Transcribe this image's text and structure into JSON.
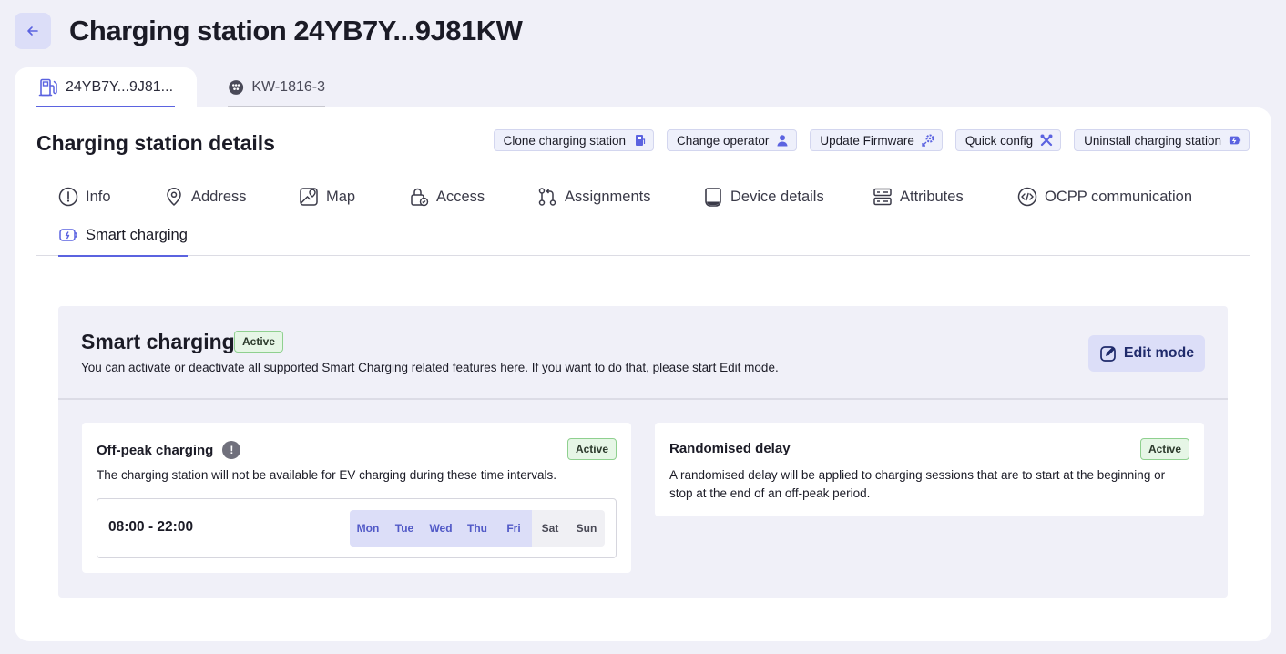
{
  "header": {
    "title_prefix": "Charging station",
    "title_id": "24YB7Y...9J81KW"
  },
  "top_tabs": [
    {
      "label": "24YB7Y...9J81...",
      "icon": "fuel-pump-icon",
      "active": true
    },
    {
      "label": "KW-1816-3",
      "icon": "ev-connector-icon",
      "active": false
    }
  ],
  "section": {
    "title": "Charging station details",
    "actions": [
      {
        "label": "Clone charging station",
        "icon": "clone-station-icon"
      },
      {
        "label": "Change operator",
        "icon": "user-icon"
      },
      {
        "label": "Update Firmware",
        "icon": "firmware-gear-icon"
      },
      {
        "label": "Quick config",
        "icon": "tools-icon"
      },
      {
        "label": "Uninstall charging station",
        "icon": "uninstall-icon"
      }
    ]
  },
  "nav_tabs": [
    {
      "label": "Info",
      "icon": "info-icon"
    },
    {
      "label": "Address",
      "icon": "location-pin-icon"
    },
    {
      "label": "Map",
      "icon": "map-icon"
    },
    {
      "label": "Access",
      "icon": "lock-icon"
    },
    {
      "label": "Assignments",
      "icon": "assignments-icon"
    },
    {
      "label": "Device details",
      "icon": "device-icon"
    },
    {
      "label": "Attributes",
      "icon": "attributes-icon"
    },
    {
      "label": "OCPP communication",
      "icon": "code-icon"
    },
    {
      "label": "Smart charging",
      "icon": "smart-charging-icon",
      "active": true
    }
  ],
  "smart_charging": {
    "title": "Smart charging",
    "status": "Active",
    "description": "You can activate or deactivate all supported Smart Charging related features here. If you want to do that, please start Edit mode.",
    "edit_label": "Edit mode"
  },
  "off_peak": {
    "title": "Off-peak charging",
    "status": "Active",
    "description": "The charging station will not be available for EV charging during these time intervals.",
    "interval": "08:00 - 22:00",
    "days": [
      {
        "label": "Mon",
        "active": true
      },
      {
        "label": "Tue",
        "active": true
      },
      {
        "label": "Wed",
        "active": true
      },
      {
        "label": "Thu",
        "active": true
      },
      {
        "label": "Fri",
        "active": true
      },
      {
        "label": "Sat",
        "active": false
      },
      {
        "label": "Sun",
        "active": false
      }
    ]
  },
  "randomised_delay": {
    "title": "Randomised delay",
    "status": "Active",
    "description": "A randomised delay will be applied to charging sessions that are to start at the beginning or stop at the end of an off-peak period."
  },
  "colors": {
    "accent": "#5b63e0",
    "active_badge_bg": "#e6f6e6",
    "active_badge_border": "#8fd08f",
    "page_bg": "#f0f0f8"
  }
}
